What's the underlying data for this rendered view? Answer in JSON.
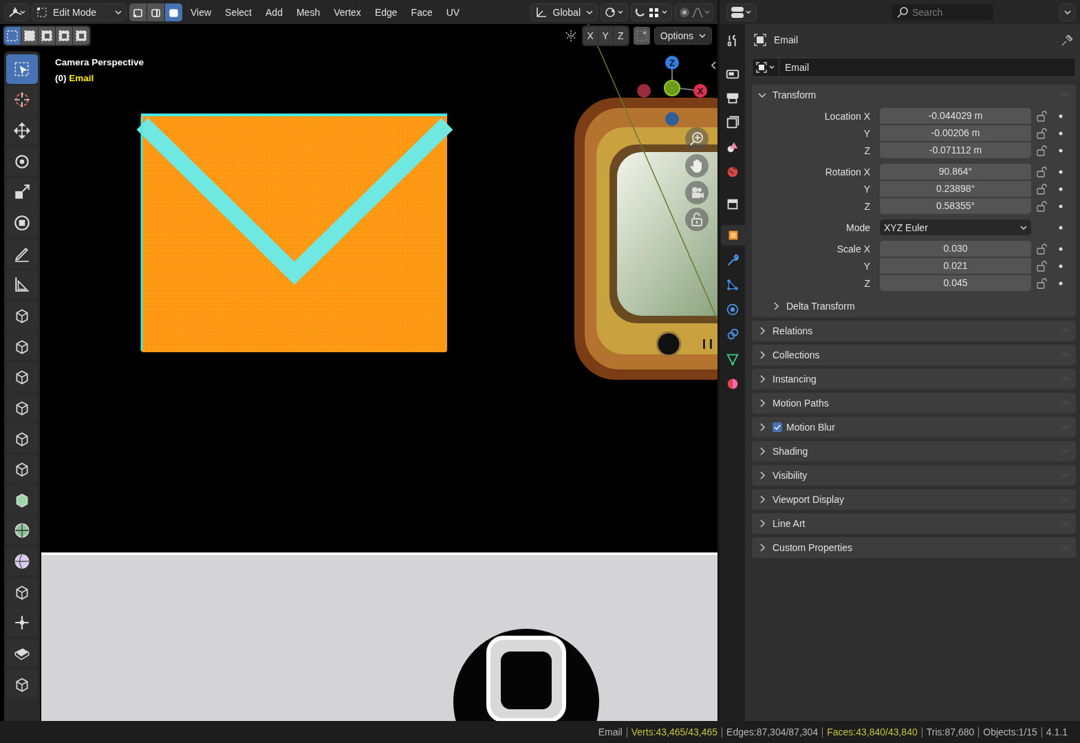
{
  "header": {
    "mode": "Edit Mode",
    "select_modes": [
      {
        "selected": false
      },
      {
        "selected": false
      },
      {
        "selected": true
      }
    ],
    "menus": [
      "View",
      "Select",
      "Add",
      "Mesh",
      "Vertex",
      "Edge",
      "Face",
      "UV"
    ],
    "orientation": "Global"
  },
  "viewport": {
    "select_tools": [
      {
        "selected": true
      },
      {
        "selected": false
      },
      {
        "selected": false
      },
      {
        "selected": false
      },
      {
        "selected": false
      }
    ],
    "axes": [
      "X",
      "Y",
      "Z"
    ],
    "options": "Options",
    "overlay_title": "Camera Perspective",
    "frame": "(0)",
    "object_name": "Email",
    "gizmo_labels": [
      "Z",
      "X"
    ]
  },
  "toolbar": {
    "tools": [
      {
        "selected": true
      },
      {
        "selected": false
      },
      {
        "selected": false
      },
      {
        "selected": false
      },
      {
        "selected": false
      },
      {
        "selected": false
      },
      {
        "selected": false
      },
      {
        "selected": false
      },
      {
        "selected": false
      },
      {
        "selected": false
      },
      {
        "selected": false
      },
      {
        "selected": false
      },
      {
        "selected": false
      },
      {
        "selected": false
      },
      {
        "selected": false
      },
      {
        "selected": false
      },
      {
        "selected": false
      },
      {
        "selected": false
      },
      {
        "selected": false
      },
      {
        "selected": false
      },
      {
        "selected": false
      }
    ]
  },
  "properties": {
    "search": {
      "placeholder": "Search"
    },
    "context": "Email",
    "datablock": "Email",
    "tabs": [
      {
        "selected": false
      },
      {
        "selected": false
      },
      {
        "selected": false
      },
      {
        "selected": false
      },
      {
        "selected": false
      },
      {
        "selected": false
      },
      {
        "selected": false
      },
      {
        "selected": true
      },
      {
        "selected": false
      },
      {
        "selected": false
      },
      {
        "selected": false
      },
      {
        "selected": false
      },
      {
        "selected": false
      },
      {
        "selected": false
      }
    ],
    "transform": {
      "title": "Transform",
      "expanded": true,
      "groups": [
        {
          "rows": [
            {
              "kind": "number",
              "label": "Location X",
              "value": "-0.044029 m"
            },
            {
              "kind": "number",
              "label": "Y",
              "value": "-0.00206 m"
            },
            {
              "kind": "number",
              "label": "Z",
              "value": "-0.071112 m"
            }
          ]
        },
        {
          "rows": [
            {
              "kind": "number",
              "label": "Rotation X",
              "value": "90.864°"
            },
            {
              "kind": "number",
              "label": "Y",
              "value": "0.23898°"
            },
            {
              "kind": "number",
              "label": "Z",
              "value": "0.58355°"
            }
          ]
        },
        {
          "rows": [
            {
              "kind": "dropdown",
              "label": "Mode",
              "value": "XYZ Euler"
            }
          ]
        },
        {
          "rows": [
            {
              "kind": "number",
              "label": "Scale X",
              "value": "0.030"
            },
            {
              "kind": "number",
              "label": "Y",
              "value": "0.021"
            },
            {
              "kind": "number",
              "label": "Z",
              "value": "0.045"
            }
          ]
        }
      ],
      "subpanel": {
        "title": "Delta Transform",
        "expanded": false
      }
    },
    "panels": [
      {
        "title": "Relations",
        "expanded": false
      },
      {
        "title": "Collections",
        "expanded": false
      },
      {
        "title": "Instancing",
        "expanded": false
      },
      {
        "title": "Motion Paths",
        "expanded": false
      },
      {
        "title": "Motion Blur",
        "expanded": false,
        "checked": true
      },
      {
        "title": "Shading",
        "expanded": false
      },
      {
        "title": "Visibility",
        "expanded": false
      },
      {
        "title": "Viewport Display",
        "expanded": false
      },
      {
        "title": "Line Art",
        "expanded": false
      },
      {
        "title": "Custom Properties",
        "expanded": false
      }
    ]
  },
  "status_bar": [
    {
      "text": "Email",
      "highlight": false
    },
    {
      "text": "Verts:43,465/43,465",
      "highlight": true
    },
    {
      "text": "Edges:87,304/87,304",
      "highlight": false
    },
    {
      "text": "Faces:43,840/43,840",
      "highlight": true
    },
    {
      "text": "Tris:87,680",
      "highlight": false
    },
    {
      "text": "Objects:1/15",
      "highlight": false
    },
    {
      "text": "4.1.1",
      "highlight": false
    }
  ]
}
